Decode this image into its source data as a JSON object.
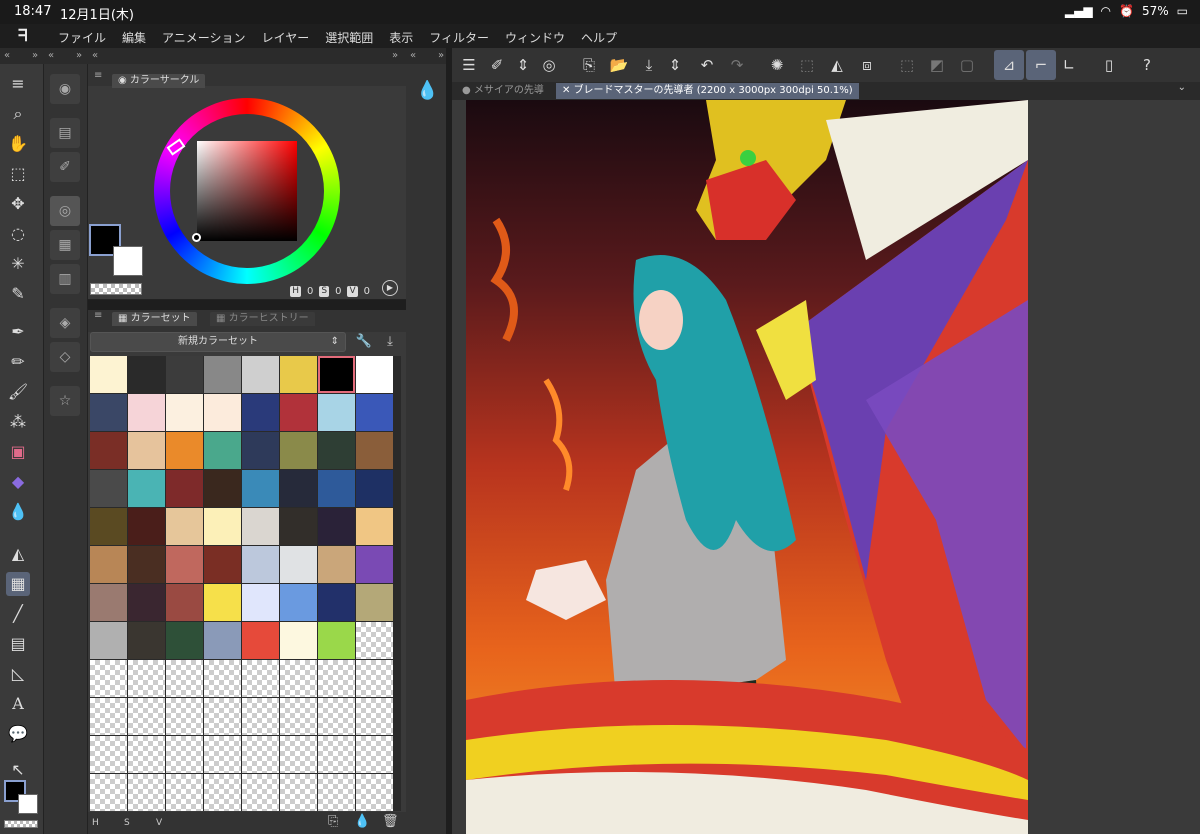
{
  "status": {
    "time": "18:47",
    "date": "12月1日(木)",
    "battery": "57%"
  },
  "menu": [
    "ファイル",
    "編集",
    "アニメーション",
    "レイヤー",
    "選択範囲",
    "表示",
    "フィルター",
    "ウィンドウ",
    "ヘルプ"
  ],
  "color_panel": {
    "tab_label": "カラーサークル",
    "main_color": "#000000",
    "sub_color": "#ffffff",
    "hsv_labels": {
      "h": "H",
      "s": "S",
      "v": "V"
    },
    "hsv_values": {
      "h": "0",
      "s": "0",
      "v": "0"
    }
  },
  "color_set": {
    "tab_label": "カラーセット",
    "tab2_label": "カラーヒストリー",
    "set_name": "新規カラーセット",
    "swatches": [
      "#fdf3d2",
      "#2a2a2a",
      "#3c3c3c",
      "#888888",
      "#cfcfcf",
      "#e8c94a",
      "#000000",
      "#ffffff",
      "#3a4766",
      "#f6d4d8",
      "#fcf0e0",
      "#fcebdc",
      "#2a3a7a",
      "#b1323a",
      "#a8d4e6",
      "#3a58b8",
      "#7a2e26",
      "#e6c39c",
      "#ea8a2a",
      "#4aa88c",
      "#2e3a5a",
      "#8a8a4a",
      "#2e3e34",
      "#8a5e3a",
      "#4a4a4a",
      "#4ab4b4",
      "#7e2a2a",
      "#3a281e",
      "#3a8ab8",
      "#262a3a",
      "#2e5a9a",
      "#1e3064",
      "#5a4a22",
      "#4a1e1a",
      "#e6c69a",
      "#fcf0b8",
      "#dad6d0",
      "#322e2a",
      "#2a2238",
      "#f0c684",
      "#b88656",
      "#4a2e22",
      "#c0685e",
      "#7a2e24",
      "#bcc8dc",
      "#e0e2e4",
      "#caa67a",
      "#7a4ab4",
      "#9a7a70",
      "#3a2630",
      "#9a4a42",
      "#f6e04a",
      "#e0e6fc",
      "#6a9ae0",
      "#22306a",
      "#b4a878",
      "#b0b0b0",
      "#3a3630",
      "#2e5038",
      "#8a9ab8",
      "#e64a3a",
      "#fdf8e0",
      "#9ad84a",
      ""
    ],
    "selected_index": 6,
    "footer": {
      "h": "H",
      "s": "S",
      "v": "V"
    }
  },
  "doc_tabs": [
    {
      "label": "メサイアの先導"
    },
    {
      "label": "ブレードマスターの先導者 (2200 x 3000px 300dpi 50.1%)"
    }
  ]
}
